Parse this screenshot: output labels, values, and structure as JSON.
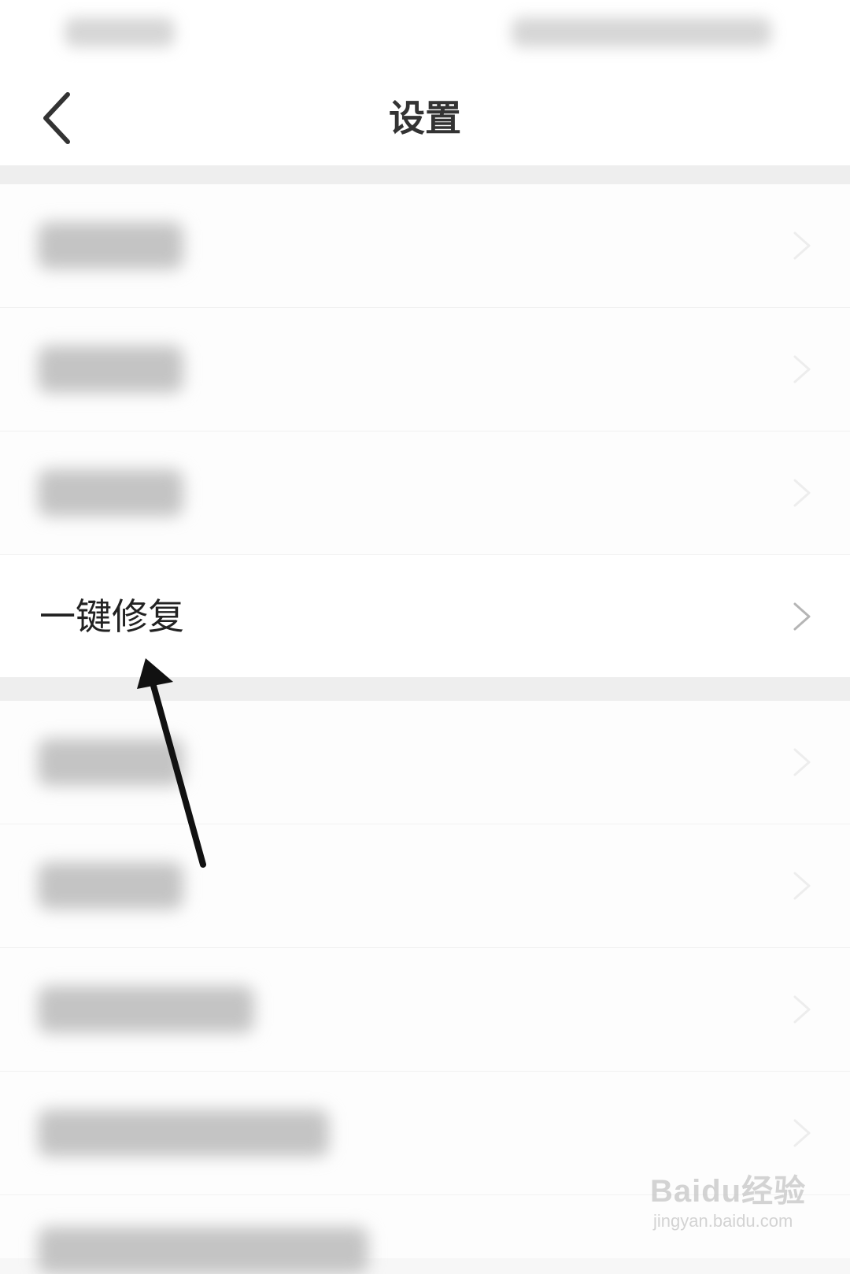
{
  "header": {
    "title": "设置",
    "back_icon": "chevron-left-icon"
  },
  "settings": {
    "repair_label": "一键修复",
    "chevron_icon": "chevron-right-icon"
  },
  "watermark": {
    "logo_text": "Baidu经验",
    "url": "jingyan.baidu.com"
  },
  "colors": {
    "text_primary": "#333333",
    "chevron": "#b5b5b5",
    "background": "#f7f7f7",
    "arrow": "#111111"
  }
}
